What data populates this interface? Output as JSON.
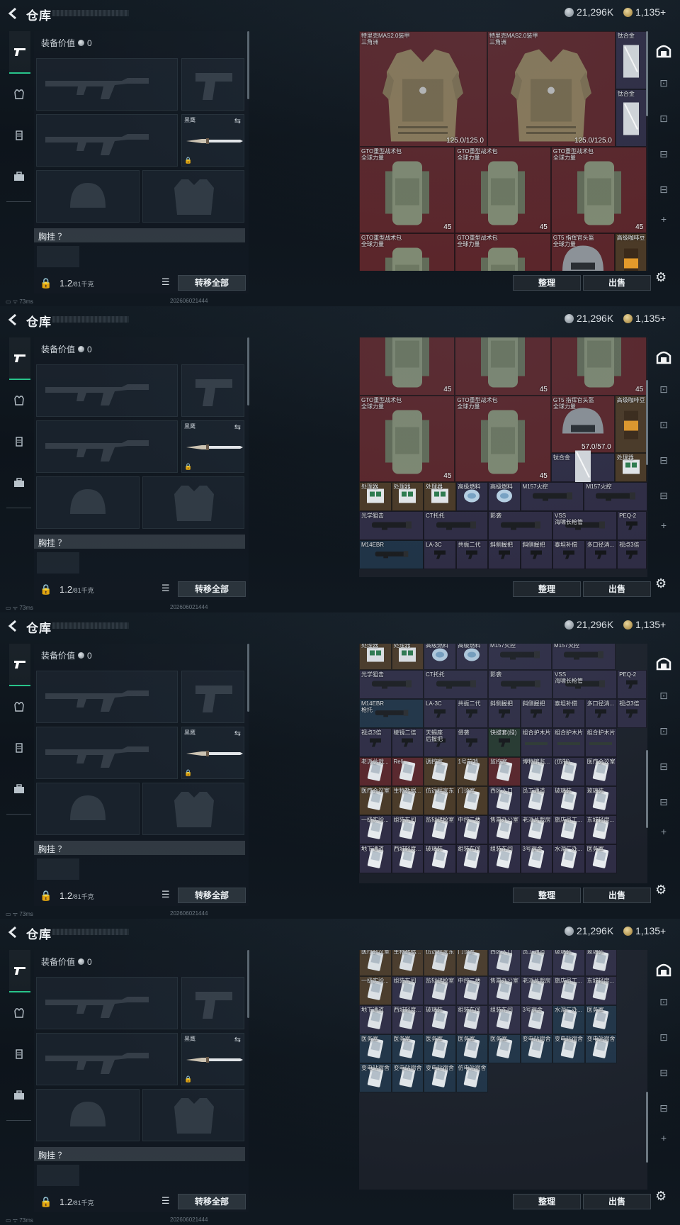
{
  "header": {
    "title": "仓库",
    "silver_amount": "21,296K",
    "gold_amount": "1,135+"
  },
  "left": {
    "equip_value_label": "装备价值",
    "equip_value": "0",
    "melee_name": "黑鹰",
    "chest_label": "胸挂 ？",
    "weight_value": "1.2",
    "weight_limit": "/81千克",
    "transfer_all": "转移全部"
  },
  "status": {
    "ping": "73ms",
    "timestamp": "202606021444"
  },
  "buttons": {
    "sort": "整理",
    "sell": "出售"
  },
  "icons": {
    "back": "back-arrow-icon",
    "lock": "lock-icon",
    "list": "list-icon",
    "gear": "gear-icon",
    "swap": "swap-icon"
  },
  "colors": {
    "accent": "#28c48a",
    "red_rarity": "#5b262b",
    "purple_rarity": "#2f2d45",
    "gold_rarity": "#4b3a27",
    "blue_rarity": "#203447"
  },
  "frames": [
    {
      "cells": [
        {
          "n": "特里克MAS2.0装甲\n三角洲",
          "v": "125.0/125.0"
        },
        {
          "n": "特里克MAS2.0装甲\n三角洲",
          "v": "125.0/125.0"
        },
        {
          "n": "钛合金",
          "v": ""
        },
        {
          "n": "钛合金",
          "v": ""
        },
        {
          "n": "GTO重型战术包\n全球力量",
          "v": "45"
        },
        {
          "n": "GTO重型战术包\n全球力量",
          "v": "45"
        },
        {
          "n": "GTO重型战术包\n全球力量",
          "v": "45"
        },
        {
          "n": "GTO重型战术包\n全球力量",
          "v": ""
        },
        {
          "n": "GTO重型战术包\n全球力量",
          "v": ""
        },
        {
          "n": "GT5 指挥官头盔\n全球力量",
          "v": ""
        },
        {
          "n": "高级咖啡豆",
          "v": ""
        }
      ]
    },
    {
      "cells": [
        {
          "n": "",
          "v": "45"
        },
        {
          "n": "",
          "v": "45"
        },
        {
          "n": "",
          "v": "45"
        },
        {
          "n": "GTO重型战术包\n全球力量",
          "v": "45"
        },
        {
          "n": "GTO重型战术包\n全球力量",
          "v": "45"
        },
        {
          "n": "GT5 指挥官头盔\n全球力量",
          "v": "57.0/57.0"
        },
        {
          "n": "高级咖啡豆",
          "v": ""
        },
        {
          "n": "钛合金",
          "v": ""
        },
        {
          "n": "处理器",
          "v": ""
        },
        {
          "n": "处理器",
          "v": ""
        },
        {
          "n": "处理器",
          "v": ""
        },
        {
          "n": "处理器",
          "v": ""
        },
        {
          "n": "高级燃料",
          "v": ""
        },
        {
          "n": "高级燃料",
          "v": ""
        },
        {
          "n": "M157火控",
          "v": ""
        },
        {
          "n": "M157火控",
          "v": ""
        },
        {
          "n": "光学狙击",
          "v": ""
        },
        {
          "n": "CT托托",
          "v": ""
        },
        {
          "n": "影袭",
          "v": ""
        },
        {
          "n": "VSS\n海啸长枪管",
          "v": ""
        },
        {
          "n": "PEQ-2",
          "v": ""
        },
        {
          "n": "M14EBR",
          "v": ""
        },
        {
          "n": "LA-3C",
          "v": ""
        },
        {
          "n": "共振二代",
          "v": ""
        },
        {
          "n": "斜侧握把",
          "v": ""
        },
        {
          "n": "斜侧握把",
          "v": ""
        },
        {
          "n": "泰坦补偿",
          "v": ""
        },
        {
          "n": "多口径消...",
          "v": ""
        },
        {
          "n": "视点3倍",
          "v": ""
        }
      ]
    },
    {
      "cells": [
        {
          "n": "处理器",
          "v": ""
        },
        {
          "n": "处理器",
          "v": ""
        },
        {
          "n": "高级燃料",
          "v": ""
        },
        {
          "n": "高级燃料",
          "v": ""
        },
        {
          "n": "M157火控",
          "v": ""
        },
        {
          "n": "M157火控",
          "v": ""
        },
        {
          "n": "光学狙击",
          "v": ""
        },
        {
          "n": "CT托托",
          "v": ""
        },
        {
          "n": "影袭",
          "v": ""
        },
        {
          "n": "VSS\n海啸长枪管",
          "v": ""
        },
        {
          "n": "PEQ-2",
          "v": ""
        },
        {
          "n": "M14EBR\n枪托",
          "v": ""
        },
        {
          "n": "LA-3C",
          "v": ""
        },
        {
          "n": "共振二代",
          "v": ""
        },
        {
          "n": "斜侧握把",
          "v": ""
        },
        {
          "n": "斜侧握把",
          "v": ""
        },
        {
          "n": "泰坦补偿",
          "v": ""
        },
        {
          "n": "多口径消...",
          "v": ""
        },
        {
          "n": "视点3倍",
          "v": ""
        },
        {
          "n": "视点3倍",
          "v": ""
        },
        {
          "n": "棱镜二倍",
          "v": ""
        },
        {
          "n": "天蝎座\n后握把",
          "v": ""
        },
        {
          "n": "侵袭",
          "v": ""
        },
        {
          "n": "快拔套(绿)",
          "v": ""
        },
        {
          "n": "组合护木片",
          "v": ""
        },
        {
          "n": "组合护木片",
          "v": ""
        },
        {
          "n": "组合护木片",
          "v": ""
        },
        {
          "n": "老派总裁...",
          "v": ""
        },
        {
          "n": "Reli...",
          "v": ""
        },
        {
          "n": "调控室",
          "v": ""
        },
        {
          "n": "1号前哨",
          "v": ""
        },
        {
          "n": "监控室",
          "v": ""
        },
        {
          "n": "博物馆监...",
          "v": ""
        },
        {
          "n": "(仿制)...",
          "v": ""
        },
        {
          "n": "医疗会议室",
          "v": ""
        },
        {
          "n": "医疗会议室",
          "v": ""
        },
        {
          "n": "生物数据...",
          "v": ""
        },
        {
          "n": "仿远程家东",
          "v": ""
        },
        {
          "n": "门诊室",
          "v": ""
        },
        {
          "n": "西区入口",
          "v": ""
        },
        {
          "n": "员工通道",
          "v": ""
        },
        {
          "n": "玻璃装",
          "v": ""
        },
        {
          "n": "玻璃装",
          "v": ""
        },
        {
          "n": "一级实验...",
          "v": ""
        },
        {
          "n": "组装车间",
          "v": ""
        },
        {
          "n": "监狱储枪室",
          "v": ""
        },
        {
          "n": "中控二楼",
          "v": ""
        },
        {
          "n": "售票办公室",
          "v": ""
        },
        {
          "n": "老派总裁房",
          "v": ""
        },
        {
          "n": "旅店员工...",
          "v": ""
        },
        {
          "n": "东城轻度...",
          "v": ""
        },
        {
          "n": "地下通道",
          "v": ""
        },
        {
          "n": "西城轻度...",
          "v": ""
        },
        {
          "n": "玻璃装",
          "v": ""
        },
        {
          "n": "组装车间",
          "v": ""
        },
        {
          "n": "组装车间",
          "v": ""
        },
        {
          "n": "3号宿舍",
          "v": ""
        },
        {
          "n": "水泥厂办...",
          "v": ""
        },
        {
          "n": "医务室",
          "v": ""
        }
      ]
    },
    {
      "cells": [
        {
          "n": "医疗会议室",
          "v": ""
        },
        {
          "n": "生物数据...",
          "v": ""
        },
        {
          "n": "仿远程家东",
          "v": ""
        },
        {
          "n": "门诊室",
          "v": ""
        },
        {
          "n": "西区入口",
          "v": ""
        },
        {
          "n": "员工通道",
          "v": ""
        },
        {
          "n": "玻璃装",
          "v": ""
        },
        {
          "n": "玻璃装",
          "v": ""
        },
        {
          "n": "一级实验...",
          "v": ""
        },
        {
          "n": "组装车间",
          "v": ""
        },
        {
          "n": "监狱储枪室",
          "v": ""
        },
        {
          "n": "中控二楼",
          "v": ""
        },
        {
          "n": "售票办公室",
          "v": ""
        },
        {
          "n": "老派总裁房",
          "v": ""
        },
        {
          "n": "旅店员工...",
          "v": ""
        },
        {
          "n": "东城轻度...",
          "v": ""
        },
        {
          "n": "地下通道",
          "v": ""
        },
        {
          "n": "西城轻度...",
          "v": ""
        },
        {
          "n": "玻璃装",
          "v": ""
        },
        {
          "n": "组装车间",
          "v": ""
        },
        {
          "n": "组装车间",
          "v": ""
        },
        {
          "n": "3号宿舍",
          "v": ""
        },
        {
          "n": "水泥厂办...",
          "v": ""
        },
        {
          "n": "医务室",
          "v": ""
        },
        {
          "n": "医务室",
          "v": ""
        },
        {
          "n": "医务室",
          "v": ""
        },
        {
          "n": "医务室",
          "v": ""
        },
        {
          "n": "医务室",
          "v": ""
        },
        {
          "n": "医务室",
          "v": ""
        },
        {
          "n": "变电站宿舍",
          "v": ""
        },
        {
          "n": "变电站宿舍",
          "v": ""
        },
        {
          "n": "变电站宿舍",
          "v": ""
        },
        {
          "n": "变电站宿舍",
          "v": ""
        },
        {
          "n": "变电站宿舍",
          "v": ""
        },
        {
          "n": "变电站宿舍",
          "v": ""
        },
        {
          "n": "仿电站宿舍",
          "v": ""
        }
      ]
    }
  ]
}
